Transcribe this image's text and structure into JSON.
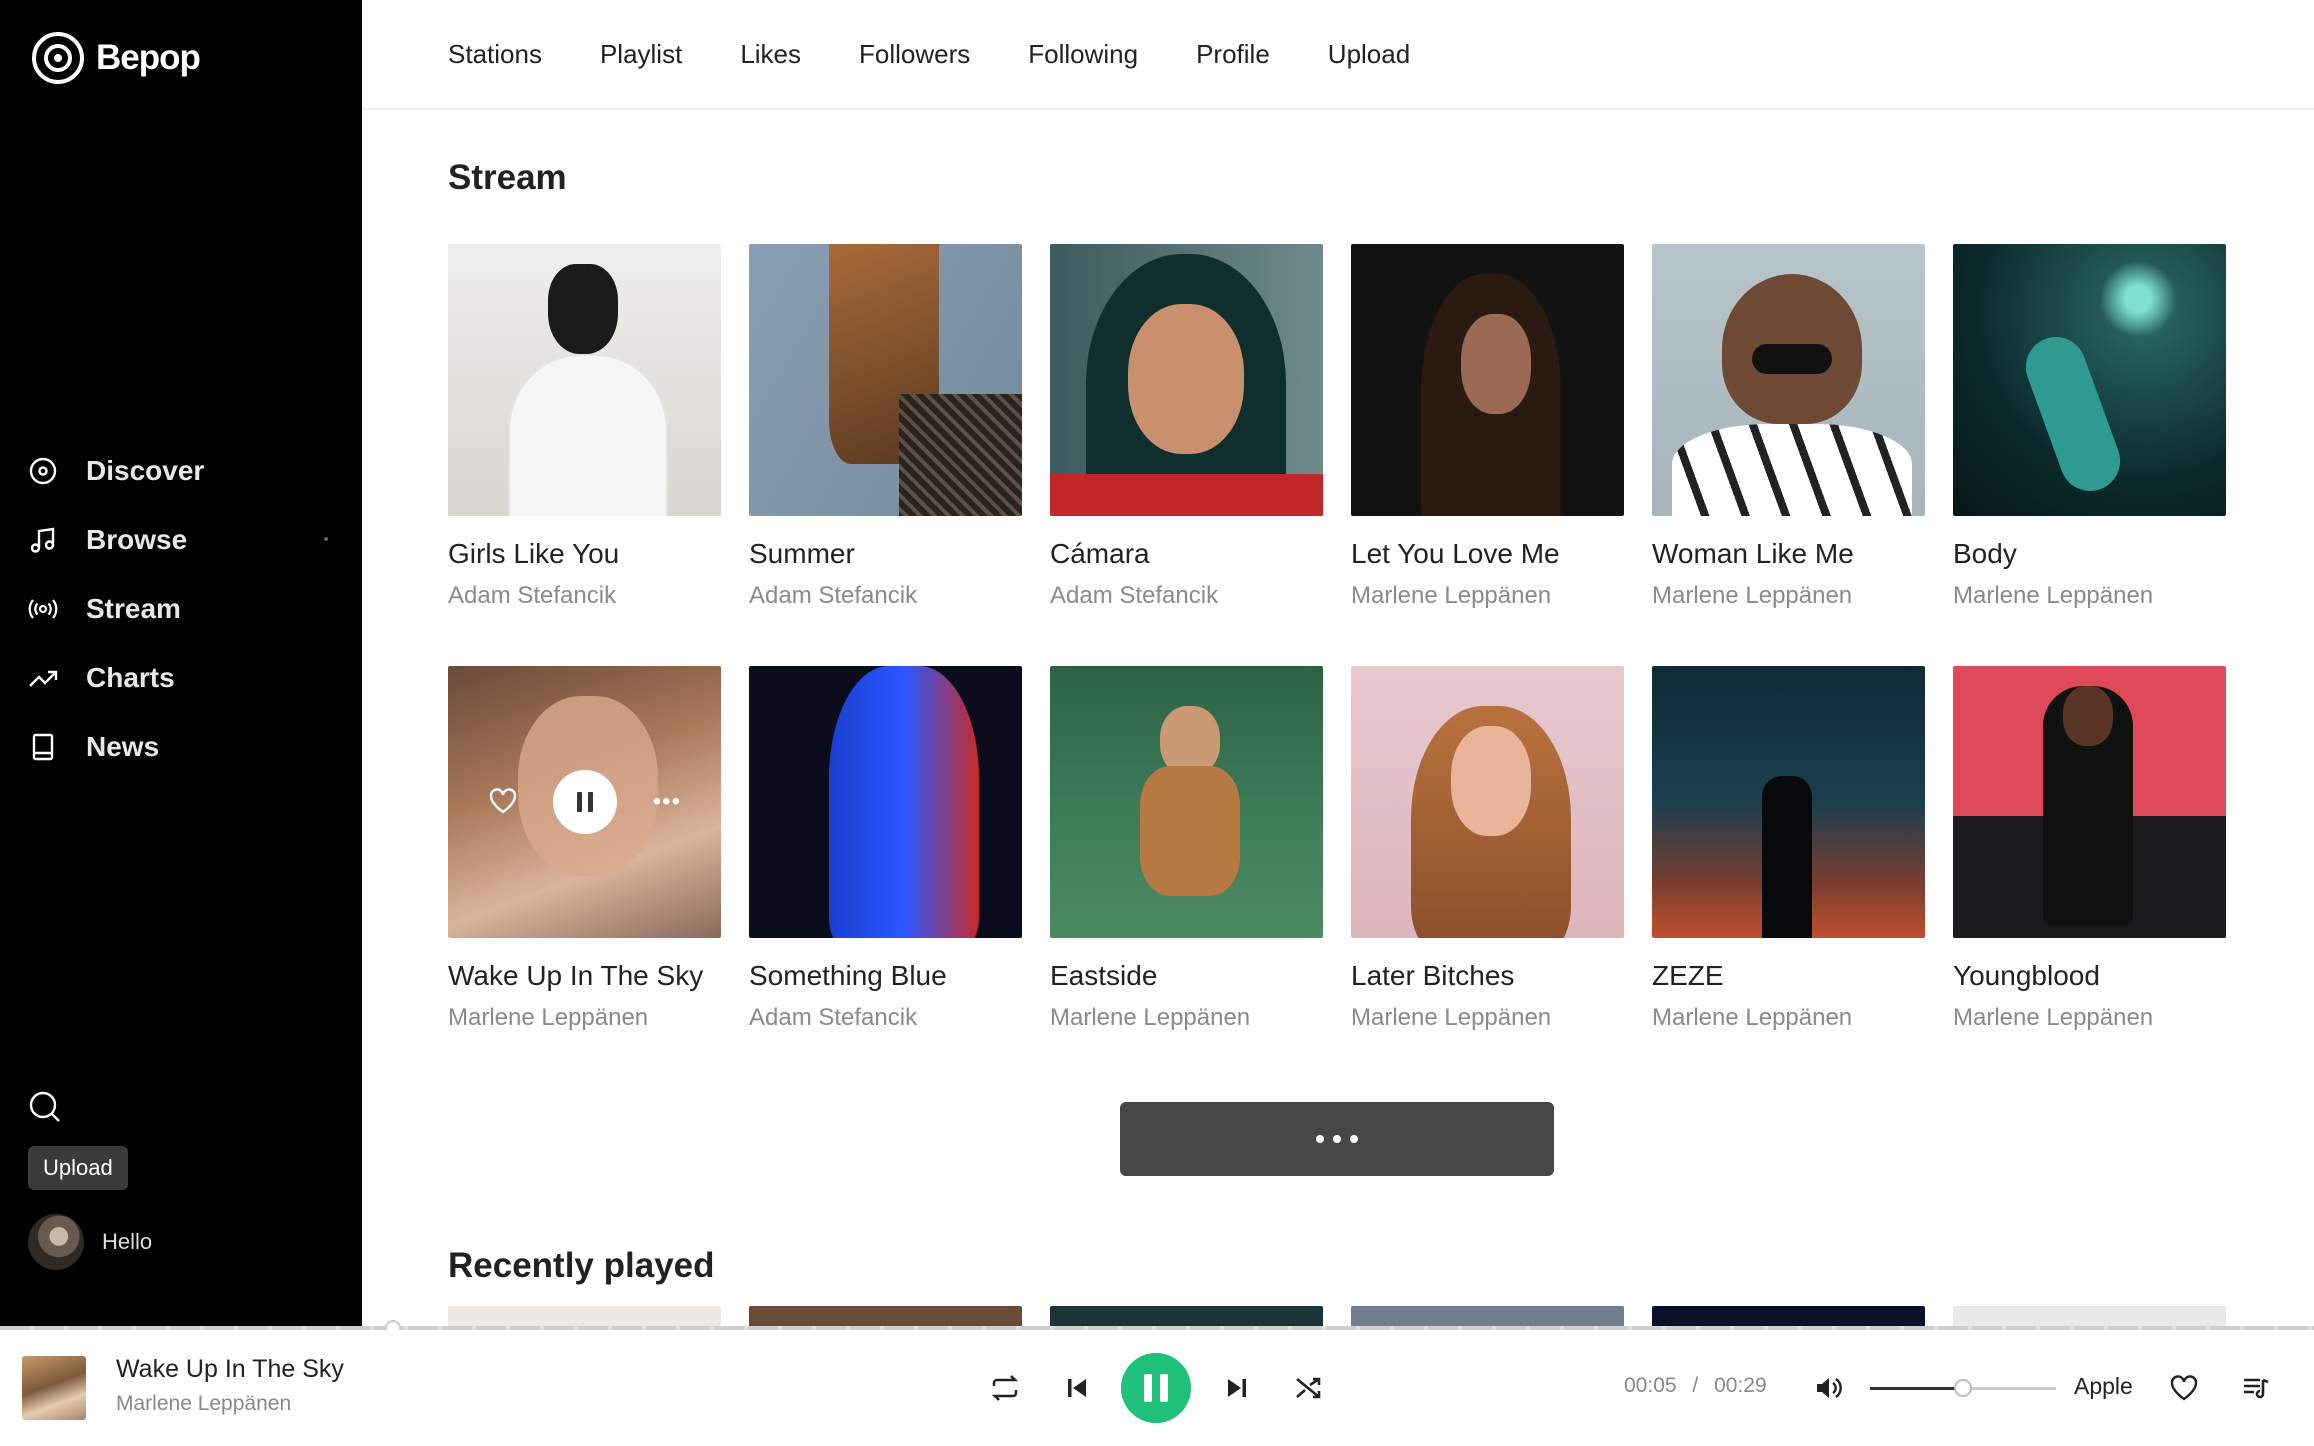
{
  "app": {
    "name": "Bepop"
  },
  "sidebar": {
    "items": [
      {
        "label": "Discover",
        "icon": "disc-icon"
      },
      {
        "label": "Browse",
        "icon": "music-note-icon"
      },
      {
        "label": "Stream",
        "icon": "broadcast-icon"
      },
      {
        "label": "Charts",
        "icon": "trending-icon"
      },
      {
        "label": "News",
        "icon": "book-icon"
      }
    ],
    "upload_label": "Upload",
    "user_label": "Hello"
  },
  "topnav": [
    "Stations",
    "Playlist",
    "Likes",
    "Followers",
    "Following",
    "Profile",
    "Upload"
  ],
  "stream": {
    "title": "Stream",
    "cards": [
      {
        "title": "Girls Like You",
        "artist": "Adam Stefancik"
      },
      {
        "title": "Summer",
        "artist": "Adam Stefancik"
      },
      {
        "title": "Cámara",
        "artist": "Adam Stefancik"
      },
      {
        "title": "Let You Love Me",
        "artist": "Marlene Leppänen"
      },
      {
        "title": "Woman Like Me",
        "artist": "Marlene Leppänen"
      },
      {
        "title": "Body",
        "artist": "Marlene Leppänen"
      },
      {
        "title": "Wake Up In The Sky",
        "artist": "Marlene Leppänen"
      },
      {
        "title": "Something Blue",
        "artist": "Adam Stefancik"
      },
      {
        "title": "Eastside",
        "artist": "Marlene Leppänen"
      },
      {
        "title": "Later Bitches",
        "artist": "Marlene Leppänen"
      },
      {
        "title": "ZEZE",
        "artist": "Marlene Leppänen"
      },
      {
        "title": "Youngblood",
        "artist": "Marlene Leppänen"
      }
    ]
  },
  "recent": {
    "title": "Recently played"
  },
  "player": {
    "title": "Wake Up In The Sky",
    "artist": "Marlene Leppänen",
    "elapsed": "00:05",
    "separator": "/",
    "duration": "00:29",
    "device": "Apple",
    "progress_fraction": 0.17,
    "volume_fraction": 0.5
  },
  "colors": {
    "sidebar": "#000000",
    "accent": "#1ec07a",
    "more_button": "#474747"
  }
}
